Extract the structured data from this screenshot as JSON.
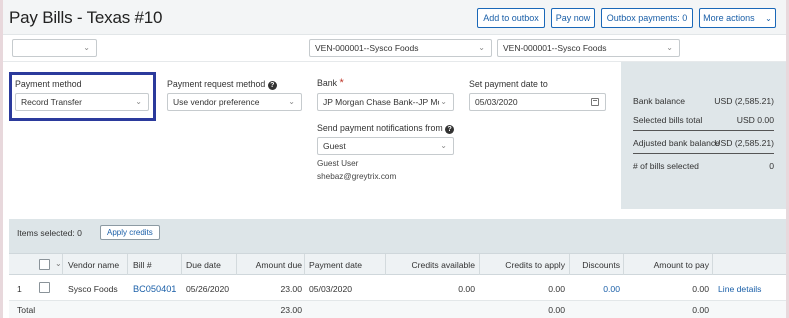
{
  "header": {
    "title": "Pay Bills - Texas #10",
    "buttons": {
      "add_to_outbox": "Add to outbox",
      "pay_now": "Pay now",
      "outbox_payments": "Outbox payments: 0",
      "more_actions": "More actions"
    }
  },
  "filters": {
    "filter1": "",
    "vendor_from": "VEN-000001--Sysco Foods",
    "vendor_to": "VEN-000001--Sysco Foods"
  },
  "form": {
    "payment_method_label": "Payment method",
    "payment_method_value": "Record Transfer",
    "payment_request_label": "Payment request method",
    "payment_request_value": "Use vendor preference",
    "bank_label": "Bank",
    "bank_required": "*",
    "bank_value": "JP Morgan Chase Bank--JP Morgan",
    "date_label": "Set payment date to",
    "date_value": "05/03/2020",
    "notify_label": "Send payment notifications from",
    "notify_value": "Guest",
    "notify_user": "Guest User",
    "notify_email": "shebaz@greytrix.com"
  },
  "balance": {
    "bank_balance_label": "Bank balance",
    "bank_balance_value": "USD (2,585.21)",
    "selected_total_label": "Selected bills total",
    "selected_total_value": "USD 0.00",
    "adjusted_label": "Adjusted bank balance",
    "adjusted_value": "USD (2,585.21)",
    "num_bills_label": "# of bills selected",
    "num_bills_value": "0"
  },
  "table": {
    "items_selected": "Items selected: 0",
    "apply_credits": "Apply credits",
    "columns": {
      "vendor_name": "Vendor name",
      "bill_no": "Bill #",
      "due_date": "Due date",
      "amount_due": "Amount due",
      "payment_date": "Payment date",
      "credits_available": "Credits available",
      "credits_to_apply": "Credits to apply",
      "discounts": "Discounts",
      "amount_to_pay": "Amount to pay"
    },
    "rows": [
      {
        "num": "1",
        "vendor_name": "Sysco Foods",
        "bill_no": "BC050401",
        "due_date": "05/26/2020",
        "amount_due": "23.00",
        "payment_date": "05/03/2020",
        "credits_available": "0.00",
        "credits_to_apply": "0.00",
        "discounts": "0.00",
        "amount_to_pay": "0.00",
        "line_details": "Line details"
      }
    ],
    "total": {
      "label": "Total",
      "amount_due": "23.00",
      "credits_to_apply": "0.00",
      "amount_to_pay": "0.00"
    }
  }
}
